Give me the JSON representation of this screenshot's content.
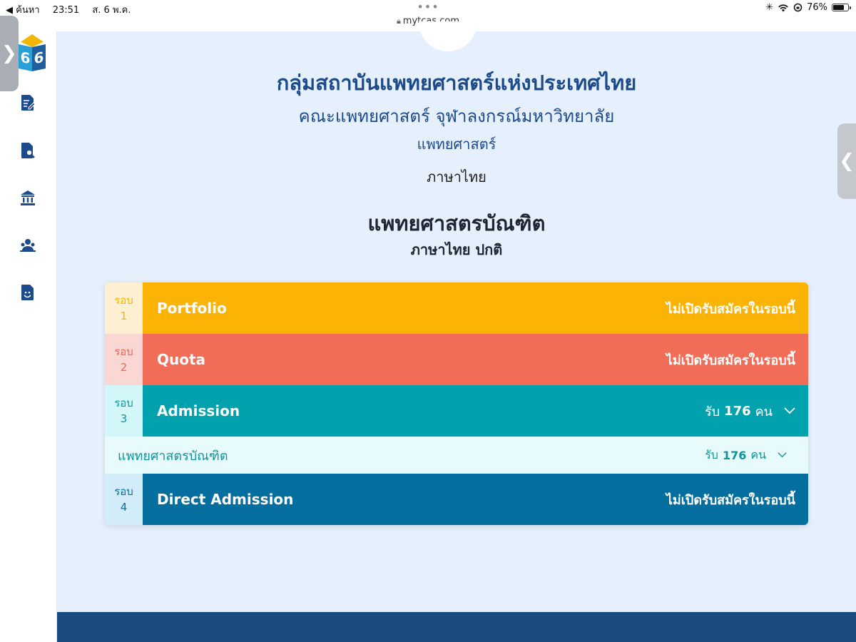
{
  "status_bar": {
    "back_app": "◀ ค้นหา",
    "time": "23:51",
    "date": "ส. 6 พ.ค.",
    "url": "mytcas.com",
    "battery": "76%",
    "battery_level": 0.76
  },
  "sidebar": {
    "logo_text": [
      "6",
      "6"
    ],
    "items": [
      {
        "icon": "document-edit-icon"
      },
      {
        "icon": "document-search-icon"
      },
      {
        "icon": "institution-icon"
      },
      {
        "icon": "user-group-icon"
      },
      {
        "icon": "document-smile-icon"
      }
    ]
  },
  "header": {
    "institution": "กลุ่มสถาบันแพทยศาสตร์แห่งประเทศไทย",
    "faculty": "คณะแพทยศาสตร์ จุฬาลงกรณ์มหาวิทยาลัย",
    "field": "แพทยศาสตร์",
    "language": "ภาษาไทย",
    "program": "แพทยศาสตรบัณฑิต",
    "program_type": "ภาษาไทย ปกติ"
  },
  "rounds": [
    {
      "label": "รอบ",
      "number": "1",
      "name": "Portfolio",
      "status": "ไม่เปิดรับสมัครในรอบนี้",
      "color": "#fbb405",
      "num_bg": "#fdf0d2",
      "num_color": "#f2b705"
    },
    {
      "label": "รอบ",
      "number": "2",
      "name": "Quota",
      "status": "ไม่เปิดรับสมัครในรอบนี้",
      "color": "#f26d57",
      "num_bg": "#fbd7d3",
      "num_color": "#e8685a"
    },
    {
      "label": "รอบ",
      "number": "3",
      "name": "Admission",
      "status_prefix": "รับ",
      "status_count": "176",
      "status_unit": "คน",
      "color": "#01a2ad",
      "num_bg": "#d3f6f9",
      "num_color": "#12939b"
    },
    {
      "label": "รอบ",
      "number": "4",
      "name": "Direct Admission",
      "status": "ไม่เปิดรับสมัครในรอบนี้",
      "color": "#046e9e",
      "num_bg": "#d3ecfa",
      "num_color": "#0b6e9d"
    }
  ],
  "admission_sub": {
    "name": "แพทยศาสตรบัณฑิต",
    "prefix": "รับ",
    "count": "176",
    "unit": "คน"
  }
}
